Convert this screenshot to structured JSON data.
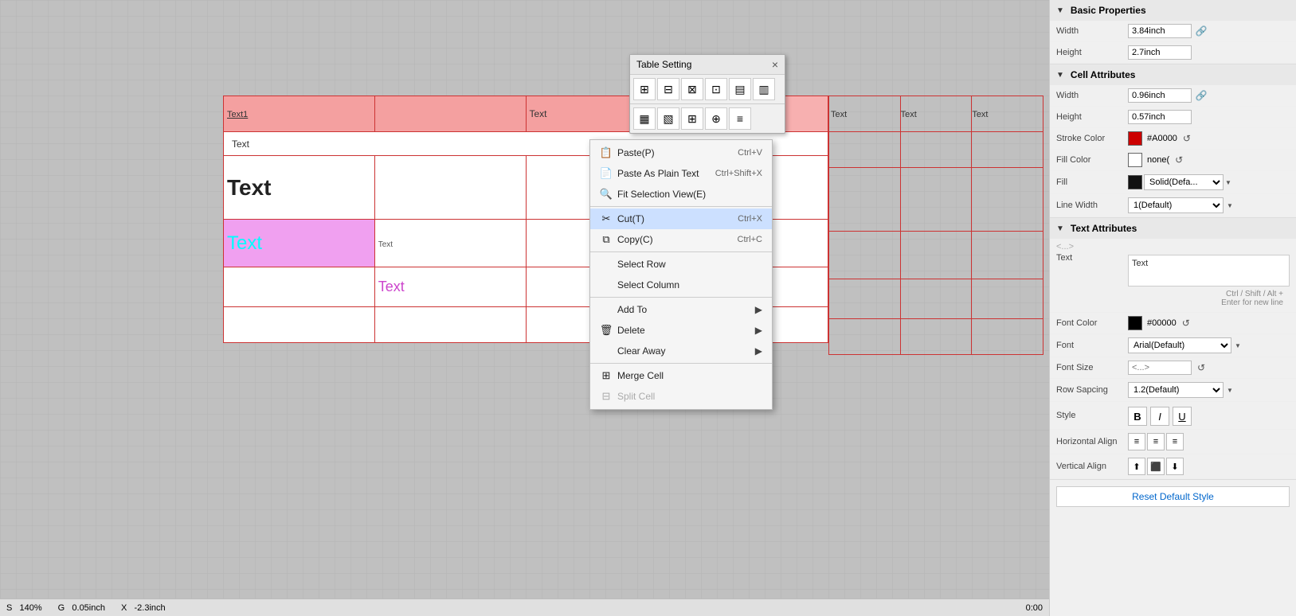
{
  "rightPanel": {
    "title": "Basic Properties",
    "width_label": "Width",
    "width_value": "3.84inch",
    "height_label": "Height",
    "height_value": "2.7inch",
    "cellAttributes": {
      "title": "Cell Attributes",
      "cell_width_label": "Width",
      "cell_width_value": "0.96inch",
      "cell_height_label": "Height",
      "cell_height_value": "0.57inch",
      "stroke_color_label": "Stroke Color",
      "stroke_color_value": "#A0000",
      "stroke_color_hex": "#cc0000",
      "fill_color_label": "Fill Color",
      "fill_color_value": "none(",
      "fill_label": "Fill",
      "fill_value": "Solid(Defa...",
      "line_width_label": "Line Width",
      "line_width_value": "1(Default)"
    },
    "textAttributes": {
      "title": "Text Attributes",
      "placeholder": "<...>",
      "text_label": "Text",
      "text_value": "Text",
      "hint": "Ctrl / Shift / Alt +\nEnter for new line",
      "font_color_label": "Font Color",
      "font_color_hex": "#000000",
      "font_color_value": "#00000",
      "font_label": "Font",
      "font_value": "Arial(Default)",
      "font_size_label": "Font Size",
      "font_size_value": "<...>",
      "row_spacing_label": "Row Sapcing",
      "row_spacing_value": "1.2(Default)",
      "style_label": "Style",
      "style_bold": "B",
      "style_italic": "I",
      "style_underline": "U",
      "h_align_label": "Horizontal Align",
      "v_align_label": "Vertical Align"
    },
    "reset_button": "Reset Default Style"
  },
  "statusBar": {
    "s_label": "S",
    "s_value": "140%",
    "g_label": "G",
    "g_value": "0.05inch",
    "x_label": "X",
    "x_value": "-2.3inch",
    "time": "0:00"
  },
  "tableSettingPopup": {
    "title": "Table Setting",
    "close": "×"
  },
  "contextMenu": {
    "items": [
      {
        "label": "Paste(P)",
        "shortcut": "Ctrl+V",
        "icon": "paste",
        "disabled": false
      },
      {
        "label": "Paste As Plain Text",
        "shortcut": "Ctrl+Shift+X",
        "icon": "paste-plain",
        "disabled": false
      },
      {
        "label": "Fit Selection View(E)",
        "shortcut": "",
        "icon": "fit",
        "disabled": false
      },
      {
        "label": "Cut(T)",
        "shortcut": "Ctrl+X",
        "icon": "cut",
        "disabled": false,
        "active": true
      },
      {
        "label": "Copy(C)",
        "shortcut": "Ctrl+C",
        "icon": "copy",
        "disabled": false
      },
      {
        "label": "Select Row",
        "shortcut": "",
        "icon": "",
        "disabled": false
      },
      {
        "label": "Select Column",
        "shortcut": "",
        "icon": "",
        "disabled": false
      },
      {
        "label": "Add To",
        "shortcut": "",
        "icon": "",
        "disabled": false,
        "arrow": true
      },
      {
        "label": "Delete",
        "shortcut": "",
        "icon": "delete",
        "disabled": false,
        "arrow": true
      },
      {
        "label": "Clear Away",
        "shortcut": "",
        "icon": "",
        "disabled": false,
        "arrow": true
      },
      {
        "label": "Merge Cell",
        "shortcut": "",
        "icon": "merge",
        "disabled": false
      },
      {
        "label": "Split Cell",
        "shortcut": "",
        "icon": "split",
        "disabled": true
      }
    ]
  },
  "tableContent": {
    "cell_text1": "Text1",
    "cell_text": "Text",
    "cell_big_text": "Text",
    "cell_cyan_text": "Text",
    "cell_magenta_text": "Text",
    "cell_small_text": "Text"
  }
}
